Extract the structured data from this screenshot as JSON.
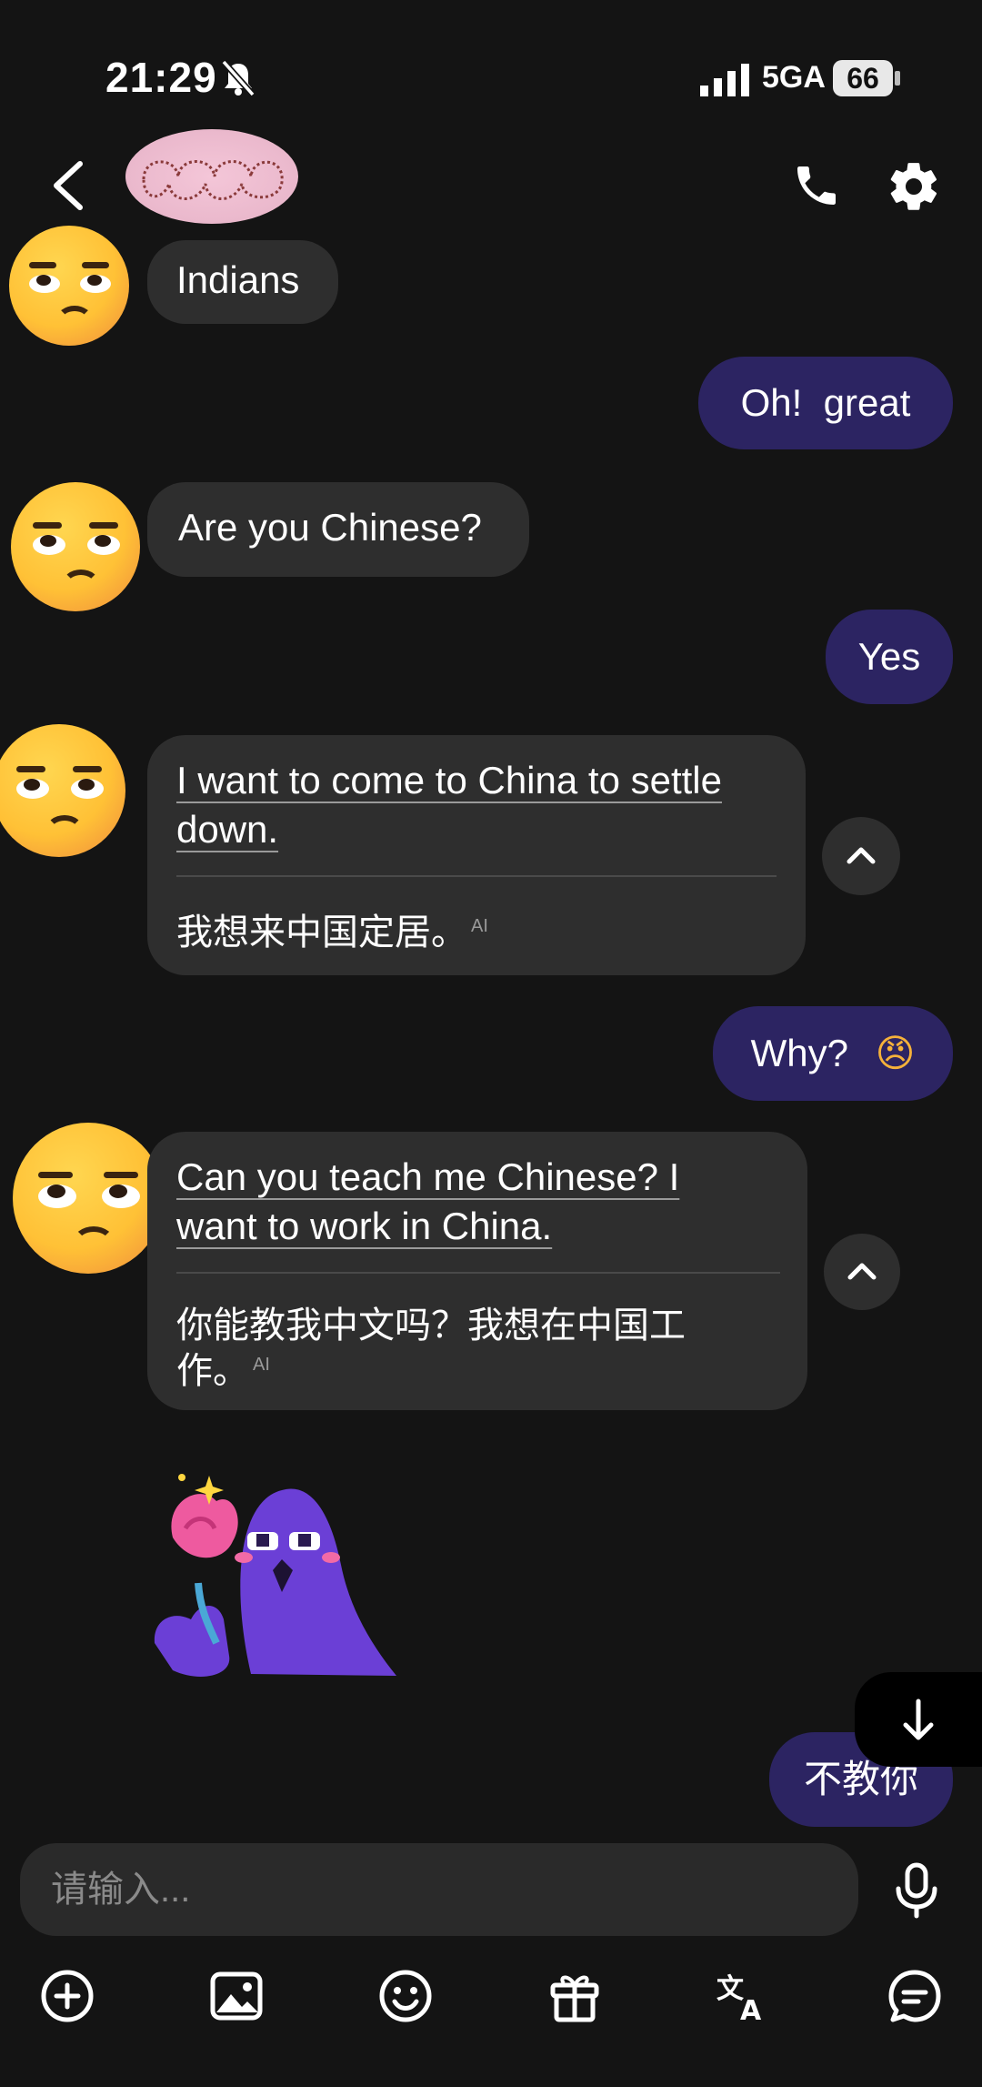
{
  "status_bar": {
    "time": "21:29",
    "network": "5GA",
    "battery": "66"
  },
  "header": {
    "back": "back",
    "contact_name": "",
    "call_icon": "phone-icon",
    "settings_icon": "gear-icon"
  },
  "messages": [
    {
      "from": "them",
      "text": "Indians"
    },
    {
      "from": "me",
      "text": "Oh!  great"
    },
    {
      "from": "them",
      "text": "Are you Chinese?"
    },
    {
      "from": "me",
      "text": "Yes"
    },
    {
      "from": "them",
      "text_line1": "I want to come to China to settle",
      "text_line2": "down.",
      "translation": "我想来中国定居。",
      "ai_tag": "AI"
    },
    {
      "from": "me",
      "text": "Why?",
      "emoji": "😠"
    },
    {
      "from": "them",
      "text_line1": "Can you teach me Chinese? I",
      "text_line2": "want to work in China.",
      "translation_line1": "你能教我中文吗？我想在中国工",
      "translation_line2": "作。",
      "ai_tag": "AI"
    },
    {
      "from": "them",
      "type": "sticker",
      "sticker": "purple-ghost-with-rose-sticker"
    },
    {
      "from": "me",
      "text": "不教你"
    }
  ],
  "input": {
    "placeholder": "请输入..."
  },
  "toolbar": [
    "plus-circle-icon",
    "image-icon",
    "smiley-icon",
    "gift-icon",
    "translate-icon",
    "chat-icon"
  ],
  "colors": {
    "background": "#141414",
    "incoming_bubble": "#2e2e2e",
    "outgoing_bubble": "#2c2462"
  }
}
